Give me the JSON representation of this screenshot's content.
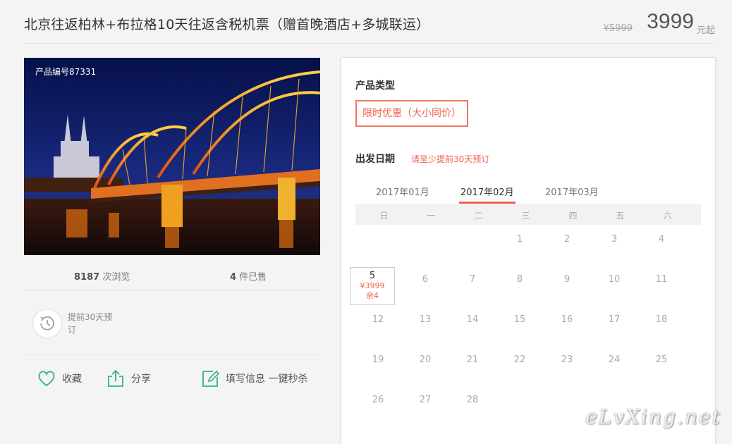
{
  "header": {
    "title": "北京往返柏林+布拉格10天往返含税机票（赠首晚酒店+多城联运）",
    "old_price": "¥5999",
    "price": "3999",
    "price_unit": "元起"
  },
  "photo": {
    "product_number": "产品编号87331"
  },
  "stats": {
    "views_count": "8187",
    "views_label": " 次浏览",
    "sold_count": "4",
    "sold_label": " 件已售"
  },
  "advance": {
    "text": "提前30天预订",
    "icon": "clock-history-icon"
  },
  "actions": {
    "favorite": "收藏",
    "share": "分享",
    "fill_info": "填写信息 一键秒杀"
  },
  "panel": {
    "type_title": "产品类型",
    "type_option": "限时优惠（大小同价）",
    "date_title": "出发日期",
    "date_hint": "请至少提前30天预订",
    "months": [
      "2017年01月",
      "2017年02月",
      "2017年03月"
    ],
    "selected_month": "2017年02月",
    "weekdays": [
      "日",
      "一",
      "二",
      "三",
      "四",
      "五",
      "六"
    ],
    "days": [
      {
        "day": "1",
        "col": 3,
        "row": 0
      },
      {
        "day": "2",
        "col": 4,
        "row": 0
      },
      {
        "day": "3",
        "col": 5,
        "row": 0
      },
      {
        "day": "4",
        "col": 6,
        "row": 0
      },
      {
        "day": "5",
        "col": 0,
        "row": 1,
        "price": "¥3999",
        "left": "余4"
      },
      {
        "day": "6",
        "col": 1,
        "row": 1
      },
      {
        "day": "7",
        "col": 2,
        "row": 1
      },
      {
        "day": "8",
        "col": 3,
        "row": 1
      },
      {
        "day": "9",
        "col": 4,
        "row": 1
      },
      {
        "day": "10",
        "col": 5,
        "row": 1
      },
      {
        "day": "11",
        "col": 6,
        "row": 1
      },
      {
        "day": "12",
        "col": 0,
        "row": 2
      },
      {
        "day": "13",
        "col": 1,
        "row": 2
      },
      {
        "day": "14",
        "col": 2,
        "row": 2
      },
      {
        "day": "15",
        "col": 3,
        "row": 2
      },
      {
        "day": "16",
        "col": 4,
        "row": 2
      },
      {
        "day": "17",
        "col": 5,
        "row": 2
      },
      {
        "day": "18",
        "col": 6,
        "row": 2
      },
      {
        "day": "19",
        "col": 0,
        "row": 3
      },
      {
        "day": "20",
        "col": 1,
        "row": 3
      },
      {
        "day": "21",
        "col": 2,
        "row": 3
      },
      {
        "day": "22",
        "col": 3,
        "row": 3
      },
      {
        "day": "23",
        "col": 4,
        "row": 3
      },
      {
        "day": "24",
        "col": 5,
        "row": 3
      },
      {
        "day": "25",
        "col": 6,
        "row": 3
      },
      {
        "day": "26",
        "col": 0,
        "row": 4
      },
      {
        "day": "27",
        "col": 1,
        "row": 4
      },
      {
        "day": "28",
        "col": 2,
        "row": 4
      }
    ]
  },
  "watermark": "eLvXing.net",
  "colors": {
    "accent": "#f06050",
    "action_icon": "#2fb47c",
    "background": "#f4f4f4"
  }
}
